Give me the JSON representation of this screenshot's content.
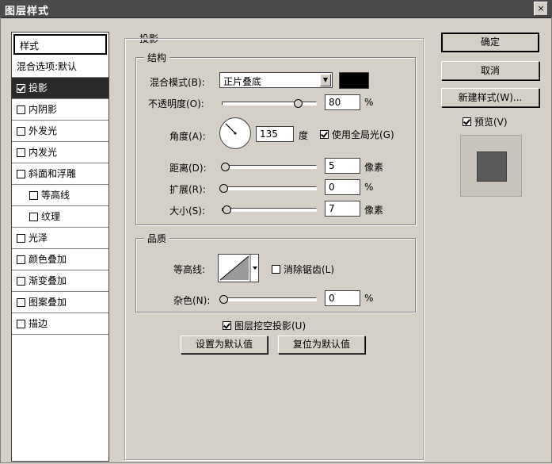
{
  "window": {
    "title": "图层样式",
    "close_label": "×"
  },
  "sidebar": {
    "header": "样式",
    "items": [
      {
        "label": "混合选项:默认",
        "checkbox": false,
        "checked": false,
        "active": false,
        "indent": false
      },
      {
        "label": "投影",
        "checkbox": true,
        "checked": true,
        "active": true,
        "indent": false
      },
      {
        "label": "内阴影",
        "checkbox": true,
        "checked": false,
        "active": false,
        "indent": false
      },
      {
        "label": "外发光",
        "checkbox": true,
        "checked": false,
        "active": false,
        "indent": false
      },
      {
        "label": "内发光",
        "checkbox": true,
        "checked": false,
        "active": false,
        "indent": false
      },
      {
        "label": "斜面和浮雕",
        "checkbox": true,
        "checked": false,
        "active": false,
        "indent": false
      },
      {
        "label": "等高线",
        "checkbox": true,
        "checked": false,
        "active": false,
        "indent": true
      },
      {
        "label": "纹理",
        "checkbox": true,
        "checked": false,
        "active": false,
        "indent": true
      },
      {
        "label": "光泽",
        "checkbox": true,
        "checked": false,
        "active": false,
        "indent": false
      },
      {
        "label": "颜色叠加",
        "checkbox": true,
        "checked": false,
        "active": false,
        "indent": false
      },
      {
        "label": "渐变叠加",
        "checkbox": true,
        "checked": false,
        "active": false,
        "indent": false
      },
      {
        "label": "图案叠加",
        "checkbox": true,
        "checked": false,
        "active": false,
        "indent": false
      },
      {
        "label": "描边",
        "checkbox": true,
        "checked": false,
        "active": false,
        "indent": false
      }
    ]
  },
  "main": {
    "section_title": "投影",
    "structure": {
      "legend": "结构",
      "blend_mode_label": "混合模式(B):",
      "blend_mode_value": "正片叠底",
      "blend_color": "#000000",
      "opacity_label": "不透明度(O):",
      "opacity_value": "80",
      "opacity_unit": "%",
      "opacity_fraction": 0.8,
      "angle_label": "角度(A):",
      "angle_value": "135",
      "angle_unit": "度",
      "angle_degrees": 135,
      "global_light_label": "使用全局光(G)",
      "global_light_checked": true,
      "distance_label": "距离(D):",
      "distance_value": "5",
      "distance_unit": "像素",
      "distance_fraction": 0.02,
      "spread_label": "扩展(R):",
      "spread_value": "0",
      "spread_unit": "%",
      "spread_fraction": 0.0,
      "size_label": "大小(S):",
      "size_value": "7",
      "size_unit": "像素",
      "size_fraction": 0.03
    },
    "quality": {
      "legend": "品质",
      "contour_label": "等高线:",
      "antialias_label": "消除锯齿(L)",
      "antialias_checked": false,
      "noise_label": "杂色(N):",
      "noise_value": "0",
      "noise_unit": "%",
      "noise_fraction": 0.0
    },
    "knockout_label": "图层挖空投影(U)",
    "knockout_checked": true,
    "set_default_label": "设置为默认值",
    "reset_default_label": "复位为默认值"
  },
  "actions": {
    "ok_label": "确定",
    "cancel_label": "取消",
    "new_style_label": "新建样式(W)...",
    "preview_label": "预览(V)",
    "preview_checked": true
  }
}
